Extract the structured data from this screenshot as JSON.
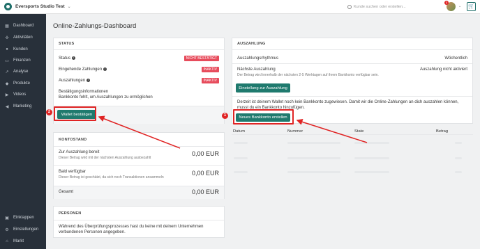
{
  "topbar": {
    "studio": "Eversports Studio Test",
    "search_placeholder": "Kunde suchen oder erstellen...",
    "notif_count": "1"
  },
  "sidebar": {
    "items": [
      {
        "label": "Dashboard",
        "icon": "dashboard-icon"
      },
      {
        "label": "Aktivitäten",
        "icon": "activity-icon"
      },
      {
        "label": "Kunden",
        "icon": "user-icon"
      },
      {
        "label": "Finanzen",
        "icon": "finance-icon"
      },
      {
        "label": "Analyse",
        "icon": "chart-icon"
      },
      {
        "label": "Produkte",
        "icon": "tag-icon"
      },
      {
        "label": "Videos",
        "icon": "video-icon"
      },
      {
        "label": "Marketing",
        "icon": "megaphone-icon"
      }
    ],
    "bottom": [
      {
        "label": "Einklappen",
        "icon": "collapse-icon"
      },
      {
        "label": "Einstellungen",
        "icon": "gear-icon"
      },
      {
        "label": "Markt",
        "icon": "store-icon"
      }
    ]
  },
  "page": {
    "title": "Online-Zahlungs-Dashboard"
  },
  "status": {
    "heading": "STATUS",
    "rows": [
      {
        "label": "Status",
        "badge": "NICHT BESTÄTIGT"
      },
      {
        "label": "Eingehende Zahlungen",
        "badge": "INAKTIV"
      },
      {
        "label": "Auszahlungen",
        "badge": "INAKTIV"
      }
    ],
    "info_title": "Bestätigungsinformationen",
    "info_text": "Bankkonto fehlt, um Auszahlungen zu ermöglichen",
    "button": "Wallet bestätigen"
  },
  "kontostand": {
    "heading": "KONTOSTAND",
    "rows": [
      {
        "label": "Zur Auszahlung bereit",
        "sub": "Dieser Betrag wird mit der nächsten Auszahlung ausbezahlt",
        "value": "0,00 EUR"
      },
      {
        "label": "Bald verfügbar",
        "sub": "Dieser Betrag ist geschätzt, da sich noch Transaktionen ansammeln",
        "value": "0,00 EUR"
      }
    ],
    "total_label": "Gesamt",
    "total_value": "0,00 EUR"
  },
  "personen": {
    "heading": "PERSONEN",
    "text": "Während des Überprüfungsprozesses hast du keine mit deinem Unternehmen verbundenen Personen angegeben."
  },
  "auszahlung": {
    "heading": "AUSZAHLUNG",
    "rhythm_label": "Auszahlungsrhythmus",
    "rhythm_value": "Wöchentlich",
    "next_label": "Nächste Auszahlung",
    "next_value": "Auszahlung nicht aktiviert",
    "next_sub": "Der Betrag wird innerhalb der nächsten 2-5 Werktagen auf ihrem Bankkonto verfügbar sein.",
    "settings_button": "Einstellung zur Auszahlung",
    "notice": "Derzeit ist deinem Wallet noch kein Bankkonto zugewiesen. Damit wir die Online-Zahlungen an dich auszahlen können, musst du ein Bankkonto hinzufügen.",
    "bank_button": "Neues Bankkonto erstellen",
    "columns": [
      "Datum",
      "Nummer",
      "State",
      "Betrag"
    ]
  },
  "annotations": {
    "first": "1",
    "second": "2"
  },
  "colors": {
    "accent": "#1f7a6e",
    "badge": "#e74c5c",
    "annotation": "#e02424",
    "sidebar": "#28303a"
  }
}
